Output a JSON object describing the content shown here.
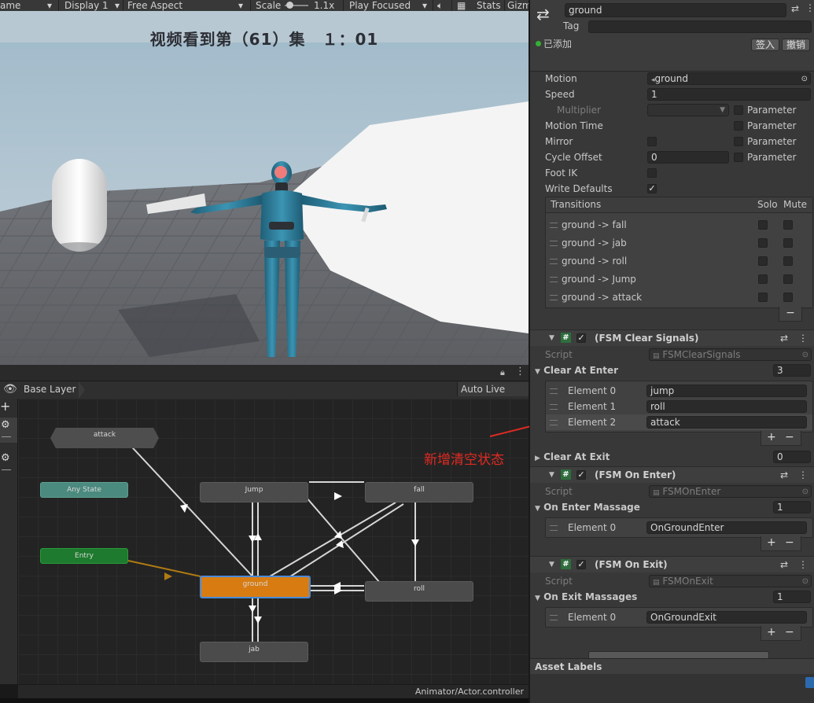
{
  "game_toolbar": {
    "game_tab": "ame",
    "display": "Display 1",
    "aspect": "Free Aspect",
    "scale_label": "Scale",
    "scale_value": "1.1x",
    "play_mode": "Play Focused",
    "stats": "Stats",
    "gizmos": "Gizm"
  },
  "overlay_text": "视频看到第（61）集　１：01",
  "animator": {
    "layer_name": "Base Layer",
    "auto_live_link": "Auto Live Link",
    "status_path": "Animator/Actor.controller",
    "nodes": {
      "attack": "attack",
      "any_state": "Any State",
      "entry": "Entry",
      "jump": "Jump",
      "fall": "fall",
      "ground": "ground",
      "roll": "roll",
      "jab": "jab"
    }
  },
  "annotation": "新增清空状态",
  "inspector": {
    "name": "ground",
    "tag_label": "Tag",
    "added_label": "已添加",
    "sign_in": "签入",
    "revert": "撤销",
    "motion_label": "Motion",
    "motion_value": "ground",
    "speed_label": "Speed",
    "speed_value": "1",
    "multiplier_label": "Multiplier",
    "parameter_label": "Parameter",
    "motion_time_label": "Motion Time",
    "mirror_label": "Mirror",
    "cycle_offset_label": "Cycle Offset",
    "cycle_offset_value": "0",
    "foot_ik_label": "Foot IK",
    "write_defaults_label": "Write Defaults",
    "transitions_label": "Transitions",
    "solo_label": "Solo",
    "mute_label": "Mute",
    "transitions": [
      "ground -> fall",
      "ground -> jab",
      "ground -> roll",
      "ground -> Jump",
      "ground -> attack"
    ],
    "script_label": "Script",
    "clear_signals": {
      "title": "(FSM Clear Signals)",
      "script": "FSMClearSignals",
      "clear_at_enter_label": "Clear At Enter",
      "clear_at_enter_count": "3",
      "elements": [
        {
          "label": "Element 0",
          "value": "jump"
        },
        {
          "label": "Element 1",
          "value": "roll"
        },
        {
          "label": "Element 2",
          "value": "attack"
        }
      ],
      "clear_at_exit_label": "Clear At Exit",
      "clear_at_exit_count": "0"
    },
    "on_enter": {
      "title": "(FSM On Enter)",
      "script": "FSMOnEnter",
      "list_label": "On Enter Massage",
      "count": "1",
      "elements": [
        {
          "label": "Element 0",
          "value": "OnGroundEnter"
        }
      ]
    },
    "on_exit": {
      "title": "(FSM On Exit)",
      "script": "FSMOnExit",
      "list_label": "On Exit Massages",
      "count": "1",
      "elements": [
        {
          "label": "Element 0",
          "value": "OnGroundExit"
        }
      ]
    },
    "asset_labels": "Asset Labels"
  }
}
